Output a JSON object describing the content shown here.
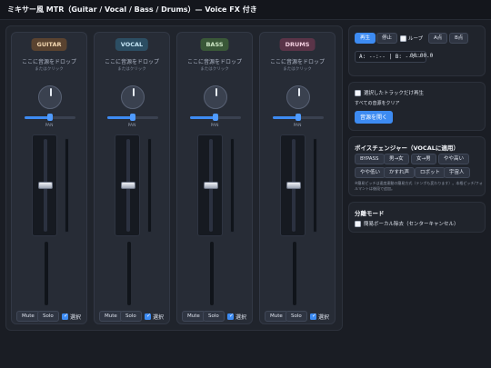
{
  "app": {
    "title": "ミキサー風 MTR（Guitar / Vocal / Bass / Drums）— Voice FX 付き"
  },
  "channels": [
    {
      "name": "GUITAR",
      "tag_bg": "#5a4330",
      "tag_fg": "#f3d7b0",
      "drop_main": "ここに音源をドロップ",
      "drop_sub": "またはクリック",
      "pan_label": "PAN",
      "mute": "Mute",
      "solo": "Solo",
      "select_label": "選択",
      "selected": true,
      "pan": 0.5,
      "fader": 0.5
    },
    {
      "name": "VOCAL",
      "tag_bg": "#2c4e63",
      "tag_fg": "#c6e6f5",
      "drop_main": "ここに音源をドロップ",
      "drop_sub": "またはクリック",
      "pan_label": "PAN",
      "mute": "Mute",
      "solo": "Solo",
      "select_label": "選択",
      "selected": true,
      "pan": 0.5,
      "fader": 0.5
    },
    {
      "name": "BASS",
      "tag_bg": "#3a5838",
      "tag_fg": "#cfe8c6",
      "drop_main": "ここに音源をドロップ",
      "drop_sub": "またはクリック",
      "pan_label": "PAN",
      "mute": "Mute",
      "solo": "Solo",
      "select_label": "選択",
      "selected": true,
      "pan": 0.5,
      "fader": 0.5
    },
    {
      "name": "DRUMS",
      "tag_bg": "#5a3448",
      "tag_fg": "#f3cfe0",
      "drop_main": "ここに音源をドロップ",
      "drop_sub": "またはクリック",
      "pan_label": "PAN",
      "mute": "Mute",
      "solo": "Solo",
      "select_label": "選択",
      "selected": true,
      "pan": 0.5,
      "fader": 0.5
    }
  ],
  "transport": {
    "play": "再生",
    "stop": "停止",
    "loop": "ループ",
    "loop_checked": false,
    "set_a": "A点",
    "set_b": "B点",
    "ab_display": "A: --:-- | B: --:--",
    "time": "00:00.0"
  },
  "selection": {
    "play_selected_label": "選択したトラックだけ再生",
    "play_selected_checked": false,
    "clear_all": "すべての音源をクリア",
    "open_audio": "音源を開く"
  },
  "voice_changer": {
    "heading": "ボイスチェンジャー（VOCALに適用）",
    "row1": [
      "BYPASS",
      "男→女",
      "女→男",
      "やや高い"
    ],
    "row2": [
      "やや低い",
      "かすれ声",
      "ロボット",
      "宇宙人"
    ],
    "note": "※簡易ピッチは速度連動の簡易方式（テンポも変わります）。本格ピッチ/フォルマントは後段で追加。"
  },
  "separation": {
    "heading": "分離モード",
    "vocal_remove_label": "簡易ボーカル除去（センターキャンセル）",
    "vocal_remove_checked": false
  }
}
